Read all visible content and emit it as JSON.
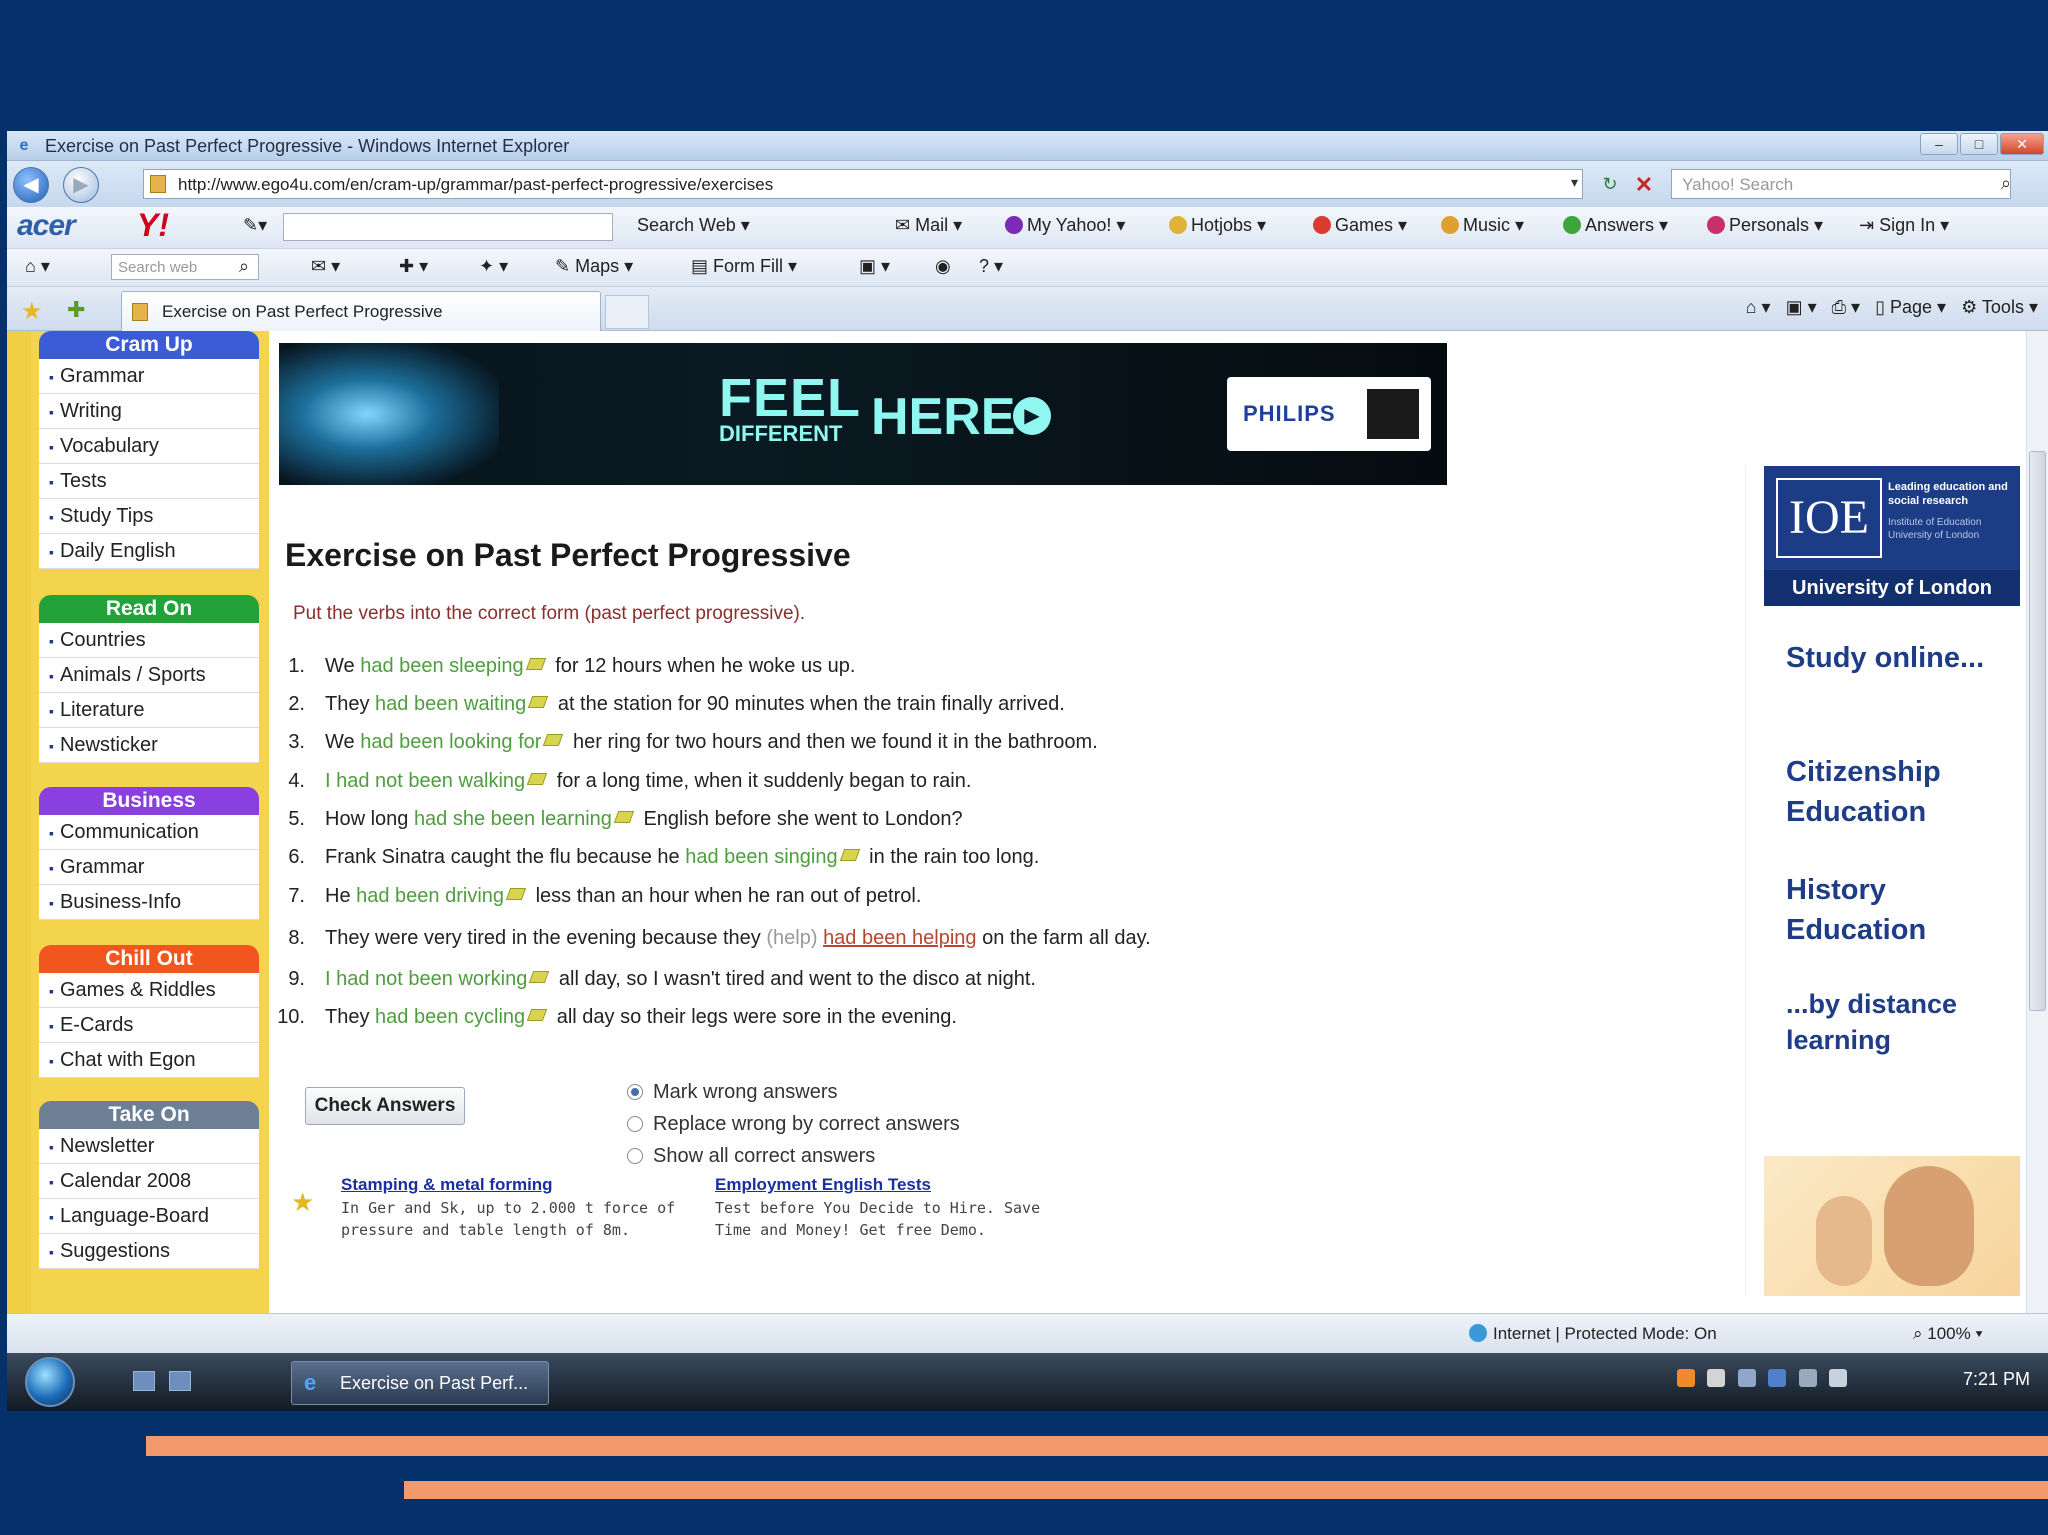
{
  "window": {
    "title": "Exercise on Past Perfect Progressive - Windows Internet Explorer"
  },
  "address_bar": {
    "url": "http://www.ego4u.com/en/cram-up/grammar/past-perfect-progressive/exercises",
    "search_placeholder": "Yahoo! Search"
  },
  "toolbar1": {
    "brand": "acer",
    "yahoo": "Y!",
    "search_web": "Search Web",
    "mail": "Mail",
    "my_yahoo": "My Yahoo!",
    "hotjobs": "Hotjobs",
    "games": "Games",
    "music": "Music",
    "answers": "Answers",
    "personals": "Personals",
    "sign_in": "Sign In"
  },
  "toolbar2": {
    "search_placeholder": "Search web",
    "maps": "Maps",
    "form_fill": "Form Fill"
  },
  "tabs": {
    "active_tab": "Exercise on Past Perfect Progressive",
    "page_menu": "Page",
    "tools_menu": "Tools"
  },
  "leftnav": [
    {
      "title": "Cram Up",
      "color": "#3b5cd6",
      "items": [
        "Grammar",
        "Writing",
        "Vocabulary",
        "Tests",
        "Study Tips",
        "Daily English"
      ]
    },
    {
      "title": "Read On",
      "color": "#24a23a",
      "items": [
        "Countries",
        "Animals / Sports",
        "Literature",
        "Newsticker"
      ]
    },
    {
      "title": "Business",
      "color": "#8a3fe0",
      "items": [
        "Communication",
        "Grammar",
        "Business-Info"
      ]
    },
    {
      "title": "Chill Out",
      "color": "#f1561e",
      "items": [
        "Games & Riddles",
        "E-Cards",
        "Chat with Egon"
      ]
    },
    {
      "title": "Take On",
      "color": "#6c7f94",
      "items": [
        "Newsletter",
        "Calendar 2008",
        "Language-Board",
        "Suggestions"
      ]
    }
  ],
  "banner": {
    "feel": "FEEL",
    "different": "DIFFERENT",
    "here": "HERE",
    "brand": "PHILIPS"
  },
  "page": {
    "title": "Exercise on Past Perfect Progressive",
    "instruction": "Put the verbs into the correct form (past perfect progressive)."
  },
  "exercises": [
    {
      "n": "1.",
      "before": "We ",
      "answer": "had been sleeping",
      "after": " for 12 hours when he woke us up."
    },
    {
      "n": "2.",
      "before": "They ",
      "answer": "had been waiting",
      "after": " at the station for 90 minutes when the train finally arrived."
    },
    {
      "n": "3.",
      "before": "We ",
      "answer": "had been looking for",
      "after": " her ring for two hours and then we found it in the bathroom."
    },
    {
      "n": "4.",
      "before": "",
      "answer": "I had not been walking",
      "after": " for a long time, when it suddenly began to rain."
    },
    {
      "n": "5.",
      "before": "How long ",
      "answer": "had she been learning",
      "after": " English before she went to London?"
    },
    {
      "n": "6.",
      "before": "Frank Sinatra caught the flu because he ",
      "answer": "had been singing",
      "after": " in the rain too long."
    },
    {
      "n": "7.",
      "before": "He ",
      "answer": "had been driving",
      "after": " less than an hour when he ran out of petrol."
    },
    {
      "n": "8.",
      "before": "They were very tired in the evening because they ",
      "hint": "(help)",
      "field": "had been helping",
      "after": " on the farm all day."
    },
    {
      "n": "9.",
      "before": "",
      "answer": "I had not been working",
      "after": " all day, so I wasn't tired and went to the disco at night."
    },
    {
      "n": "10.",
      "before": "They ",
      "answer": "had been cycling",
      "after": " all day so their legs were sore in the evening."
    }
  ],
  "controls": {
    "check_button": "Check Answers",
    "options": [
      "Mark wrong answers",
      "Replace wrong by correct answers",
      "Show all correct answers"
    ]
  },
  "ads": [
    {
      "title": "Stamping & metal forming",
      "line1": "In Ger and Sk, up to 2.000 t force of",
      "line2": "pressure and table length of 8m."
    },
    {
      "title": "Employment English Tests",
      "line1": "Test before You Decide to Hire. Save",
      "line2": "Time and Money! Get free Demo."
    }
  ],
  "right_ad": {
    "logo": "IOE",
    "tagline": "Leading education and social research",
    "subtag": "Institute of Education University of London",
    "university": "University of London",
    "study_online": "Study online...",
    "citizenship": "Citizenship Education",
    "history": "History Education",
    "distance": "...by distance learning"
  },
  "statusbar": {
    "zone": "Internet | Protected Mode: On",
    "zoom": "100%"
  },
  "taskbar": {
    "task": "Exercise on Past Perf...",
    "clock": "7:21 PM"
  }
}
